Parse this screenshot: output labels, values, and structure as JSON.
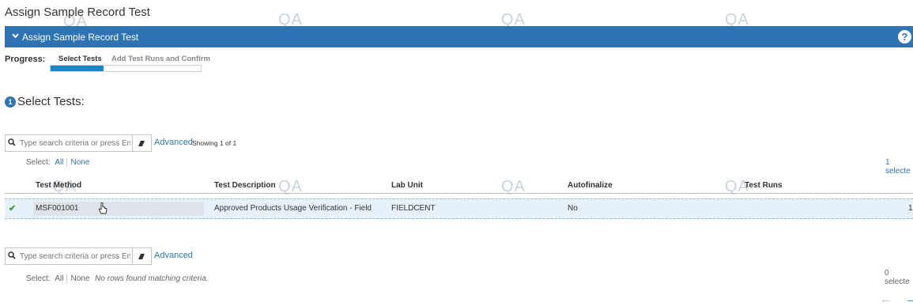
{
  "page": {
    "title": "Assign Sample Record Test",
    "watermark": "QA"
  },
  "banner": {
    "title": "Assign Sample Record Test",
    "help_symbol": "?"
  },
  "progress": {
    "label": "Progress:",
    "steps": [
      "Select Tests",
      "Add Test Runs and Confirm"
    ],
    "fill_fraction": 0.35
  },
  "section": {
    "step_number": "1",
    "title": "Select Tests:"
  },
  "search1": {
    "placeholder": "Type search criteria or press Enter",
    "advanced_label": "Advanced",
    "showing": "Showing 1 of 1",
    "select_label": "Select:",
    "all_label": "All",
    "none_label": "None",
    "selected_count": "1 selecte"
  },
  "table": {
    "headers": [
      "Test Method",
      "Test Description",
      "Lab Unit",
      "Autofinalize",
      "Test Runs"
    ],
    "rows": [
      {
        "test_method": "MSF001001",
        "test_description": "Approved Products Usage Verification - Field",
        "lab_unit": "FIELDCENT",
        "autofinalize": "No",
        "test_runs": "1"
      }
    ]
  },
  "search2": {
    "placeholder": "Type search criteria or press Enter",
    "advanced_label": "Advanced",
    "select_label": "Select:",
    "all_label": "All",
    "none_label": "None",
    "empty_message": "No rows found matching criteria.",
    "selected_count": "0 selecte"
  },
  "icons": {
    "chevron": "chevron-down",
    "search": "magnifier",
    "eraser": "eraser",
    "check": "checkmark",
    "back": "arrow-left",
    "forward": "arrow-right"
  },
  "colors": {
    "accent": "#2e74b5",
    "progress_fill": "#1a86c8",
    "row_selected": "#e6f1fb",
    "check": "#3a9a3a"
  }
}
